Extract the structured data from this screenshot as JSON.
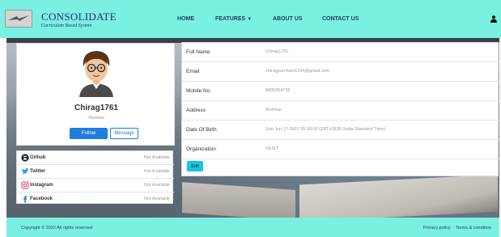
{
  "brand": {
    "title": "CONSOLIDATE",
    "subtitle": "Curriculum Based System"
  },
  "nav": {
    "home": "HOME",
    "features": "FEATURES",
    "about": "ABOUT US",
    "contact": "CONTACT US",
    "user_icon": "user-icon"
  },
  "profile": {
    "name": "Chirag1761",
    "city": "Mumbai",
    "follow_label": "Follow",
    "message_label": "Message"
  },
  "social": [
    {
      "label": "Github",
      "value": "Not Available",
      "icon": "github-icon"
    },
    {
      "label": "Twitter",
      "value": "Not Available",
      "icon": "twitter-icon"
    },
    {
      "label": "Instagram",
      "value": "Not Available",
      "icon": "instagram-icon"
    },
    {
      "label": "Facebook",
      "value": "Not Available",
      "icon": "facebook-icon"
    }
  ],
  "details": [
    {
      "label": "Full Name",
      "value": "Chirag1761"
    },
    {
      "label": "Email",
      "value": "chiragparchani1234@gmail.com"
    },
    {
      "label": "Mobile No.",
      "value": "8600354733"
    },
    {
      "label": "Address",
      "value": "Mumbai"
    },
    {
      "label": "Date Of Birth",
      "value": "Sun Jun 17 2001 05:30:00 GMT+0530 (India Standard Time)"
    },
    {
      "label": "Organization",
      "value": "VESIT"
    }
  ],
  "edit_label": "Edit",
  "footer": {
    "copyright": "Copyright © 2022 All rights reserved",
    "privacy": "Privacy policy",
    "terms": "Terms & condition"
  },
  "colors": {
    "navbar": "#7af0e2",
    "primary": "#1e7de0",
    "edit": "#17c6e3"
  }
}
